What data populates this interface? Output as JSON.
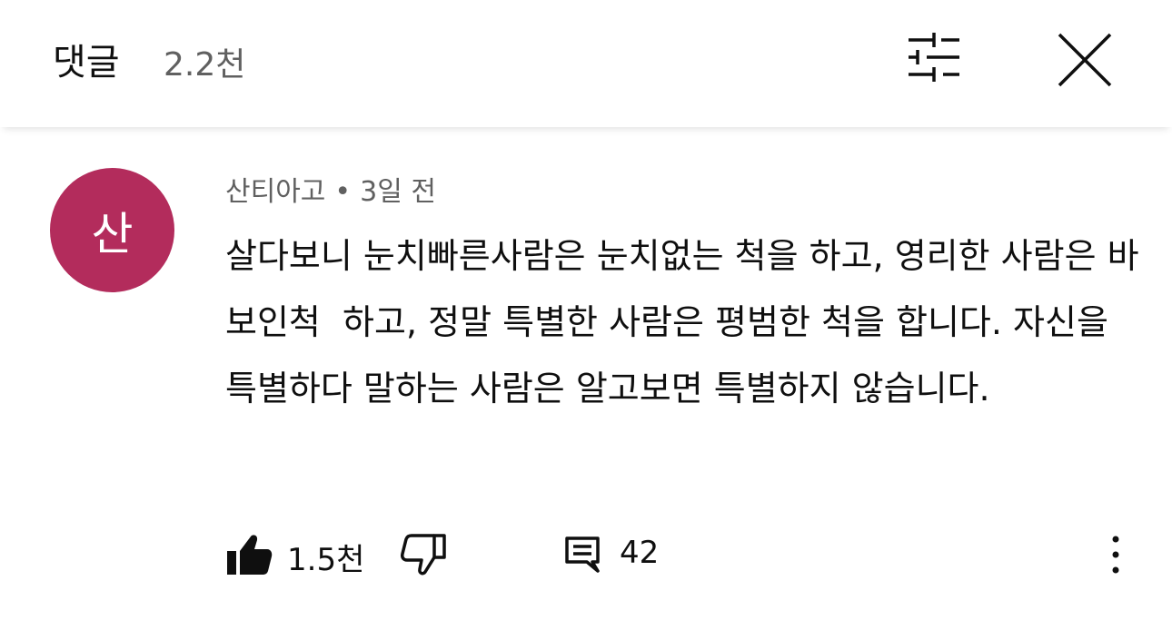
{
  "header": {
    "title": "댓글",
    "count": "2.2천",
    "filter_icon": "sort-filter-icon",
    "close_icon": "close-icon"
  },
  "comment": {
    "avatar_letter": "산",
    "avatar_color": "#b32c5c",
    "author": "산티아고",
    "separator": "•",
    "time": "3일 전",
    "text": "살다보니 눈치빠른사람은 눈치없는 척을 하고, 영리한 사람은 바보인척  하고, 정말 특별한 사람은 평범한 척을 합니다. 자신을 특별하다 말하는 사람은 알고보면 특별하지 않습니다.",
    "likes": "1.5천",
    "replies": "42"
  }
}
